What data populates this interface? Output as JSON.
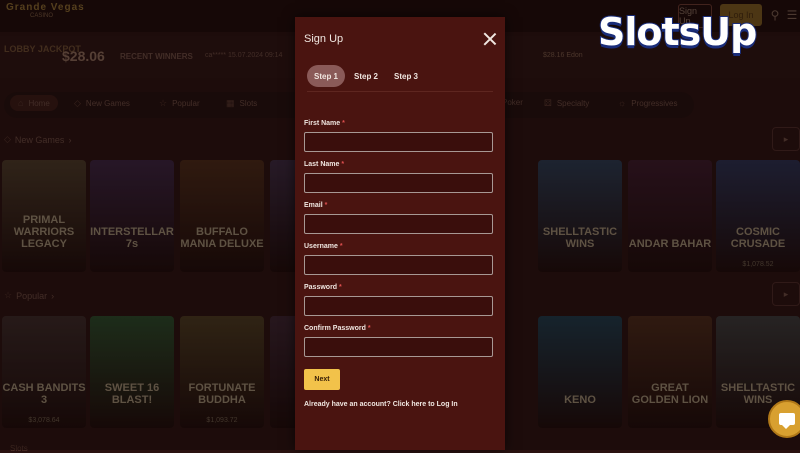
{
  "brand": {
    "name_part1": "Slots",
    "name_part2": "Up"
  },
  "site_header": {
    "logo": "Grande Vegas",
    "logo_sub": "CASINO",
    "signup_label": "Sign Up",
    "login_label": "Log In"
  },
  "jackpot": {
    "logo": "LOBBY JACKPOT",
    "amount": "$28.06",
    "recent_winners_label": "RECENT WINNERS",
    "recent_item": "ca***** 15.07.2024 09:14",
    "recent_right": "$28.16 Edon"
  },
  "categories": [
    {
      "label": "Home",
      "icon": "home-icon"
    },
    {
      "label": "New Games",
      "icon": "diamond-icon"
    },
    {
      "label": "Popular",
      "icon": "star-icon"
    },
    {
      "label": "Slots",
      "icon": "slot-icon"
    },
    {
      "label": "Poker",
      "icon": "cards-icon"
    },
    {
      "label": "Specialty",
      "icon": "dice-icon"
    },
    {
      "label": "Progressives",
      "icon": "sun-icon"
    }
  ],
  "sections": {
    "new_games": "New Games",
    "popular": "Popular",
    "slots": "Slots"
  },
  "new_games_tiles": [
    {
      "name": "PRIMAL WARRIORS LEGACY",
      "price": "",
      "color": "#4a3a28"
    },
    {
      "name": "INTERSTELLAR 7s",
      "price": "",
      "color": "#3a2440"
    },
    {
      "name": "BUFFALO MANIA DELUXE",
      "price": "",
      "color": "#4a2a18"
    },
    {
      "name": "",
      "price": "",
      "color": "#3a2a40"
    },
    {
      "name": "SHELLTASTIC WINS",
      "price": "",
      "color": "#2a3a50"
    },
    {
      "name": "ANDAR BAHAR",
      "price": "",
      "color": "#3a1a2a"
    },
    {
      "name": "COSMIC CRUSADE",
      "price": "$1,078.52",
      "color": "#2a3050"
    }
  ],
  "popular_tiles": [
    {
      "name": "CASH BANDITS 3",
      "price": "$3,078.64",
      "color": "#3a2a28"
    },
    {
      "name": "SWEET 16 BLAST!",
      "price": "",
      "color": "#2a4a2a"
    },
    {
      "name": "FORTUNATE BUDDHA",
      "price": "$1,093.72",
      "color": "#4a3a20"
    },
    {
      "name": "",
      "price": "",
      "color": "#3a2430"
    },
    {
      "name": "KENO",
      "price": "",
      "color": "#1e3a4a"
    },
    {
      "name": "GREAT GOLDEN LION",
      "price": "",
      "color": "#4a2a1a"
    },
    {
      "name": "SHELLTASTIC WINS",
      "price": "",
      "color": "#3a3a3a"
    }
  ],
  "signup_modal": {
    "title": "Sign Up",
    "steps": [
      "Step 1",
      "Step 2",
      "Step 3"
    ],
    "active_step": "Step 1",
    "required_marker": "*",
    "fields": [
      {
        "label": "First Name",
        "value": ""
      },
      {
        "label": "Last Name",
        "value": ""
      },
      {
        "label": "Email",
        "value": ""
      },
      {
        "label": "Username",
        "value": ""
      },
      {
        "label": "Password",
        "value": ""
      },
      {
        "label": "Confirm Password",
        "value": ""
      }
    ],
    "next_label": "Next",
    "login_prompt": "Already have an account? Click here to Log In"
  },
  "colors": {
    "modal_bg": "#4a1410",
    "accent_button": "#f2c24a",
    "required": "#e05050",
    "active_step": "#8a5a58"
  }
}
